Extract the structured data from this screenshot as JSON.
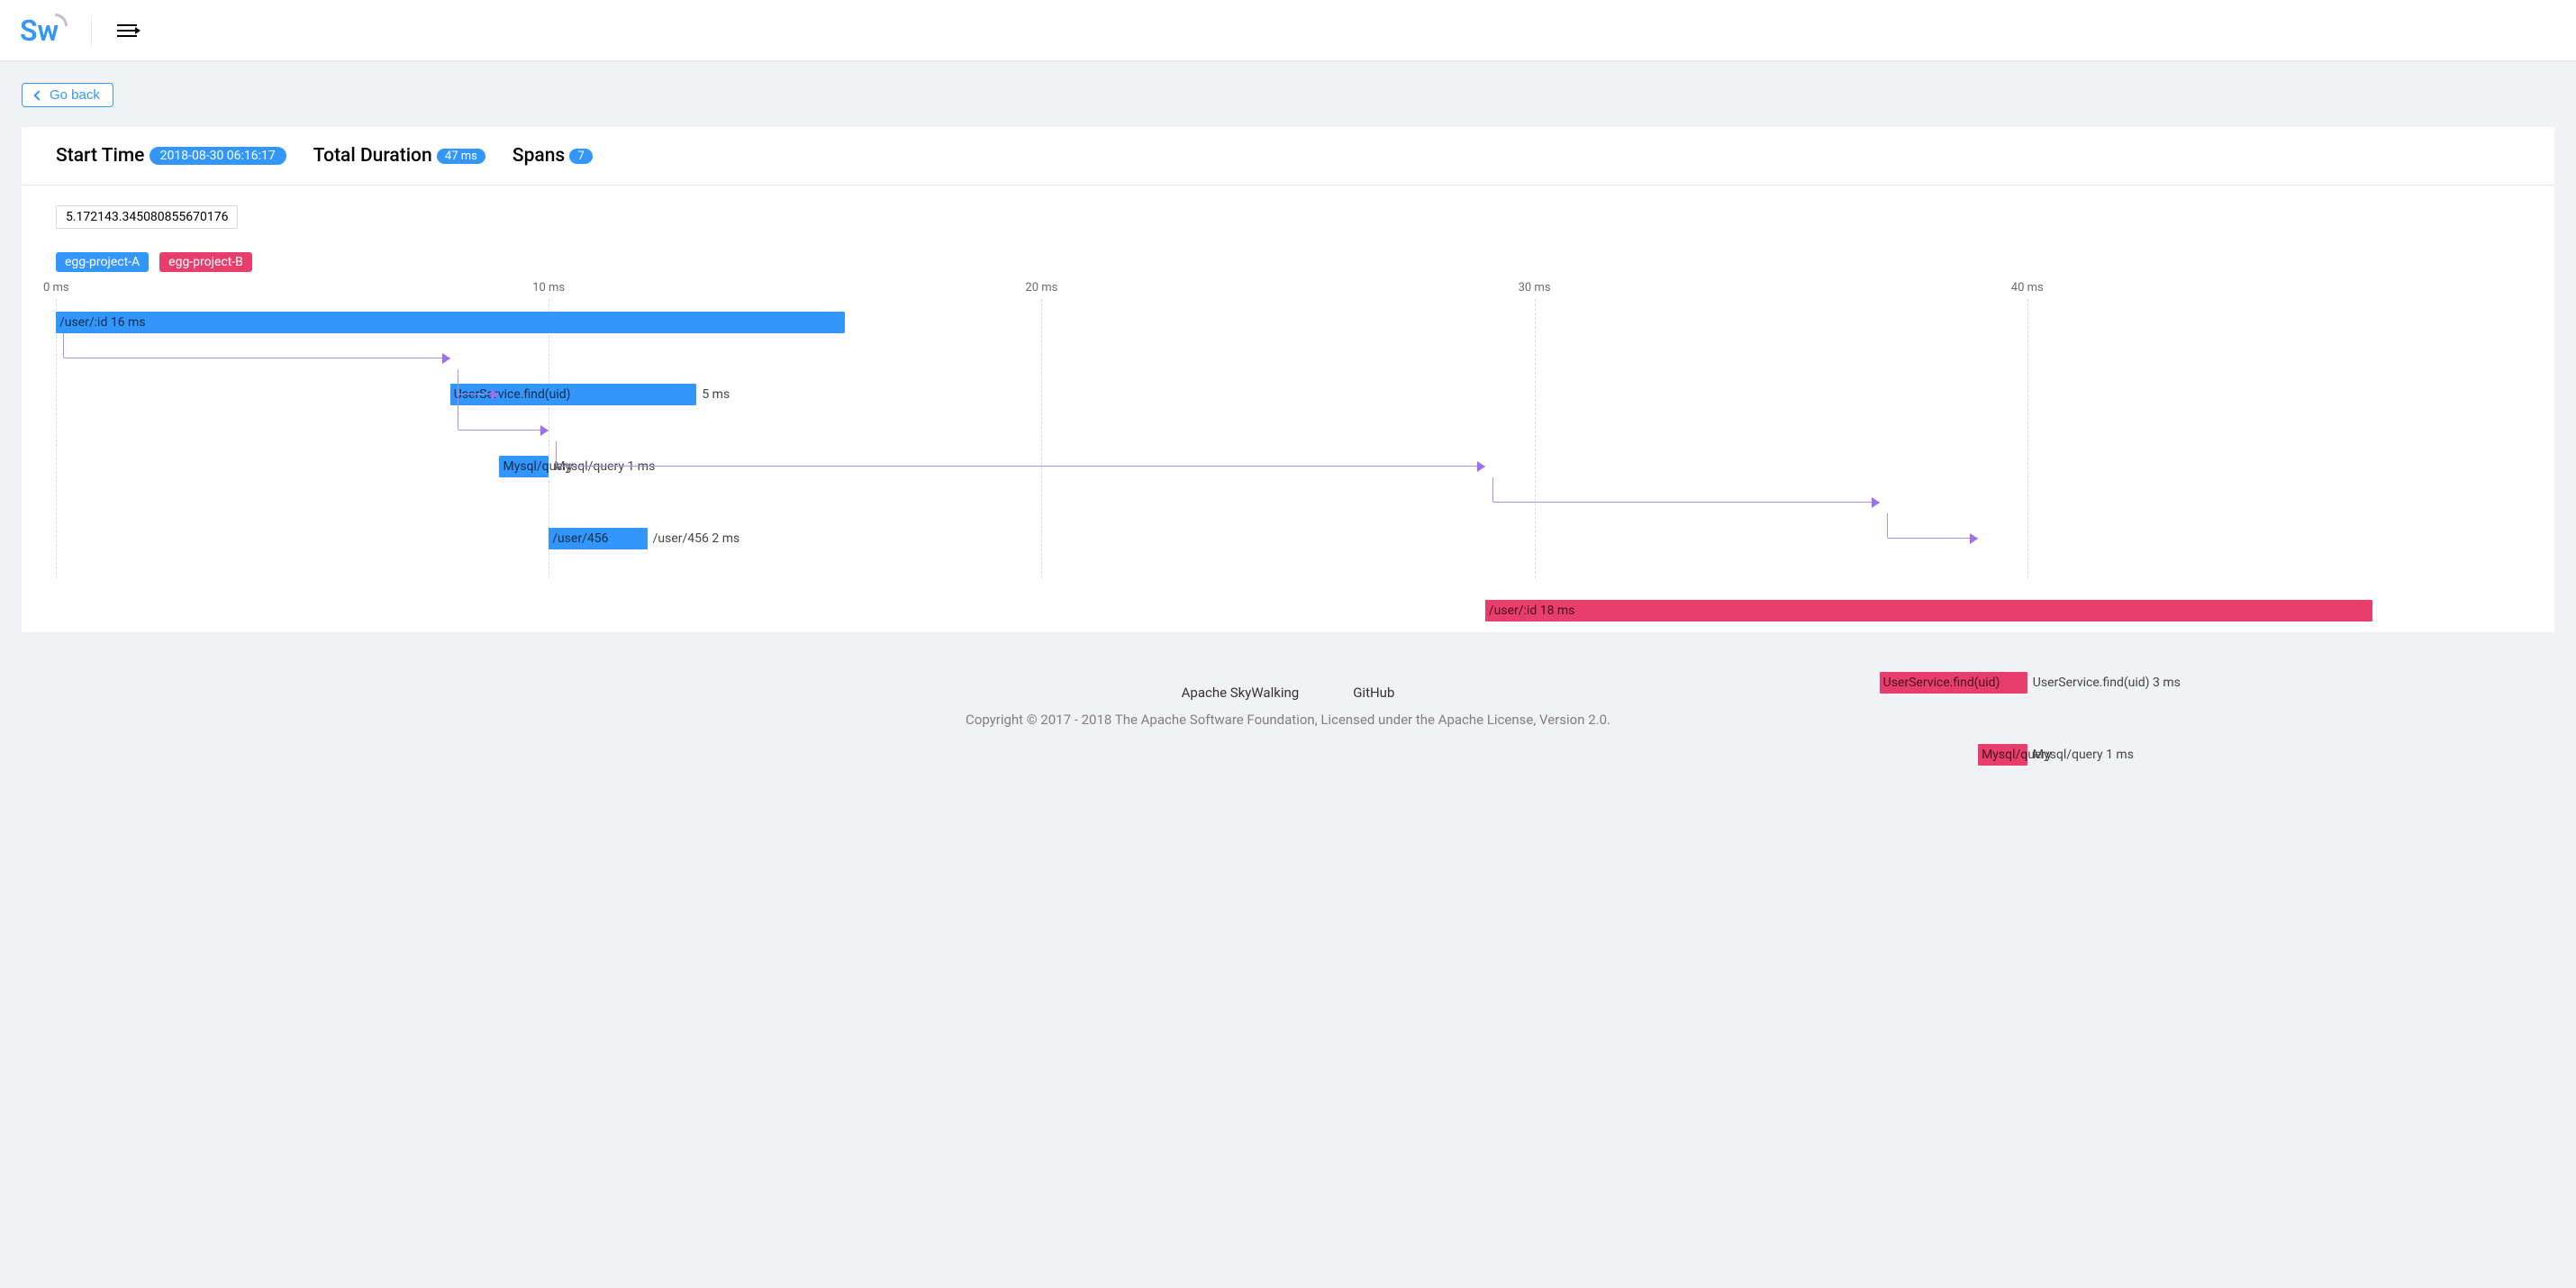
{
  "nav": {
    "brand_s": "S",
    "brand_w": "w"
  },
  "actions": {
    "go_back": "Go back"
  },
  "summary": {
    "start_time_label": "Start Time",
    "start_time_value": "2018-08-30 06:16:17",
    "duration_label": "Total Duration",
    "duration_value": "47 ms",
    "spans_label": "Spans",
    "spans_value": "7"
  },
  "trace_id": "5.172143.345080855670176",
  "legend": [
    {
      "label": "egg-project-A",
      "color": "blue"
    },
    {
      "label": "egg-project-B",
      "color": "pink"
    }
  ],
  "axis": {
    "ticks": [
      {
        "label": "0 ms",
        "pct": 0
      },
      {
        "label": "10 ms",
        "pct": 20
      },
      {
        "label": "20 ms",
        "pct": 40
      },
      {
        "label": "30 ms",
        "pct": 60
      },
      {
        "label": "40 ms",
        "pct": 80
      }
    ]
  },
  "chart_data": {
    "type": "gantt",
    "unit": "ms",
    "x_domain": [
      0,
      50
    ],
    "rows": [
      {
        "id": 0,
        "parent": null,
        "service": "egg-project-A",
        "color": "blue",
        "name": "/user/:id",
        "start": 0,
        "dur": 16,
        "label_inside": "/user/:id 16 ms",
        "label_outside": ""
      },
      {
        "id": 1,
        "parent": 0,
        "service": "egg-project-A",
        "color": "blue",
        "name": "UserService.find(uid)",
        "start": 8,
        "dur": 5,
        "label_inside": "UserService.find(uid)",
        "label_outside": "5 ms"
      },
      {
        "id": 2,
        "parent": 1,
        "service": "egg-project-A",
        "color": "blue",
        "name": "Mysql/query",
        "start": 9,
        "dur": 1,
        "label_inside": "Mysql/query",
        "label_outside": "1 ms",
        "right_label": "Mysql/query 1 ms"
      },
      {
        "id": 3,
        "parent": 1,
        "service": "egg-project-A",
        "color": "blue",
        "name": "/user/456",
        "start": 10,
        "dur": 2,
        "label_inside": "/user/456",
        "label_outside": "2 ms",
        "right_label": "/user/456 2 ms"
      },
      {
        "id": 4,
        "parent": 3,
        "service": "egg-project-B",
        "color": "pink",
        "name": "/user/:id",
        "start": 29,
        "dur": 18,
        "label_inside": "/user/:id 18 ms",
        "label_outside": ""
      },
      {
        "id": 5,
        "parent": 4,
        "service": "egg-project-B",
        "color": "pink",
        "name": "UserService.find(uid)",
        "start": 37,
        "dur": 3,
        "label_inside": "UserService.find(uid)",
        "label_outside": "3 ms",
        "right_label": "UserService.find(uid) 3 ms"
      },
      {
        "id": 6,
        "parent": 5,
        "service": "egg-project-B",
        "color": "pink",
        "name": "Mysql/query",
        "start": 39,
        "dur": 1,
        "label_inside": "Mysql/query",
        "label_outside": "1 ms",
        "right_label": "Mysql/query 1 ms"
      }
    ]
  },
  "footer": {
    "link1": "Apache SkyWalking",
    "link2": "GitHub",
    "copyright": "Copyright © 2017 - 2018 The Apache Software Foundation, Licensed under the Apache License, Version 2.0."
  }
}
